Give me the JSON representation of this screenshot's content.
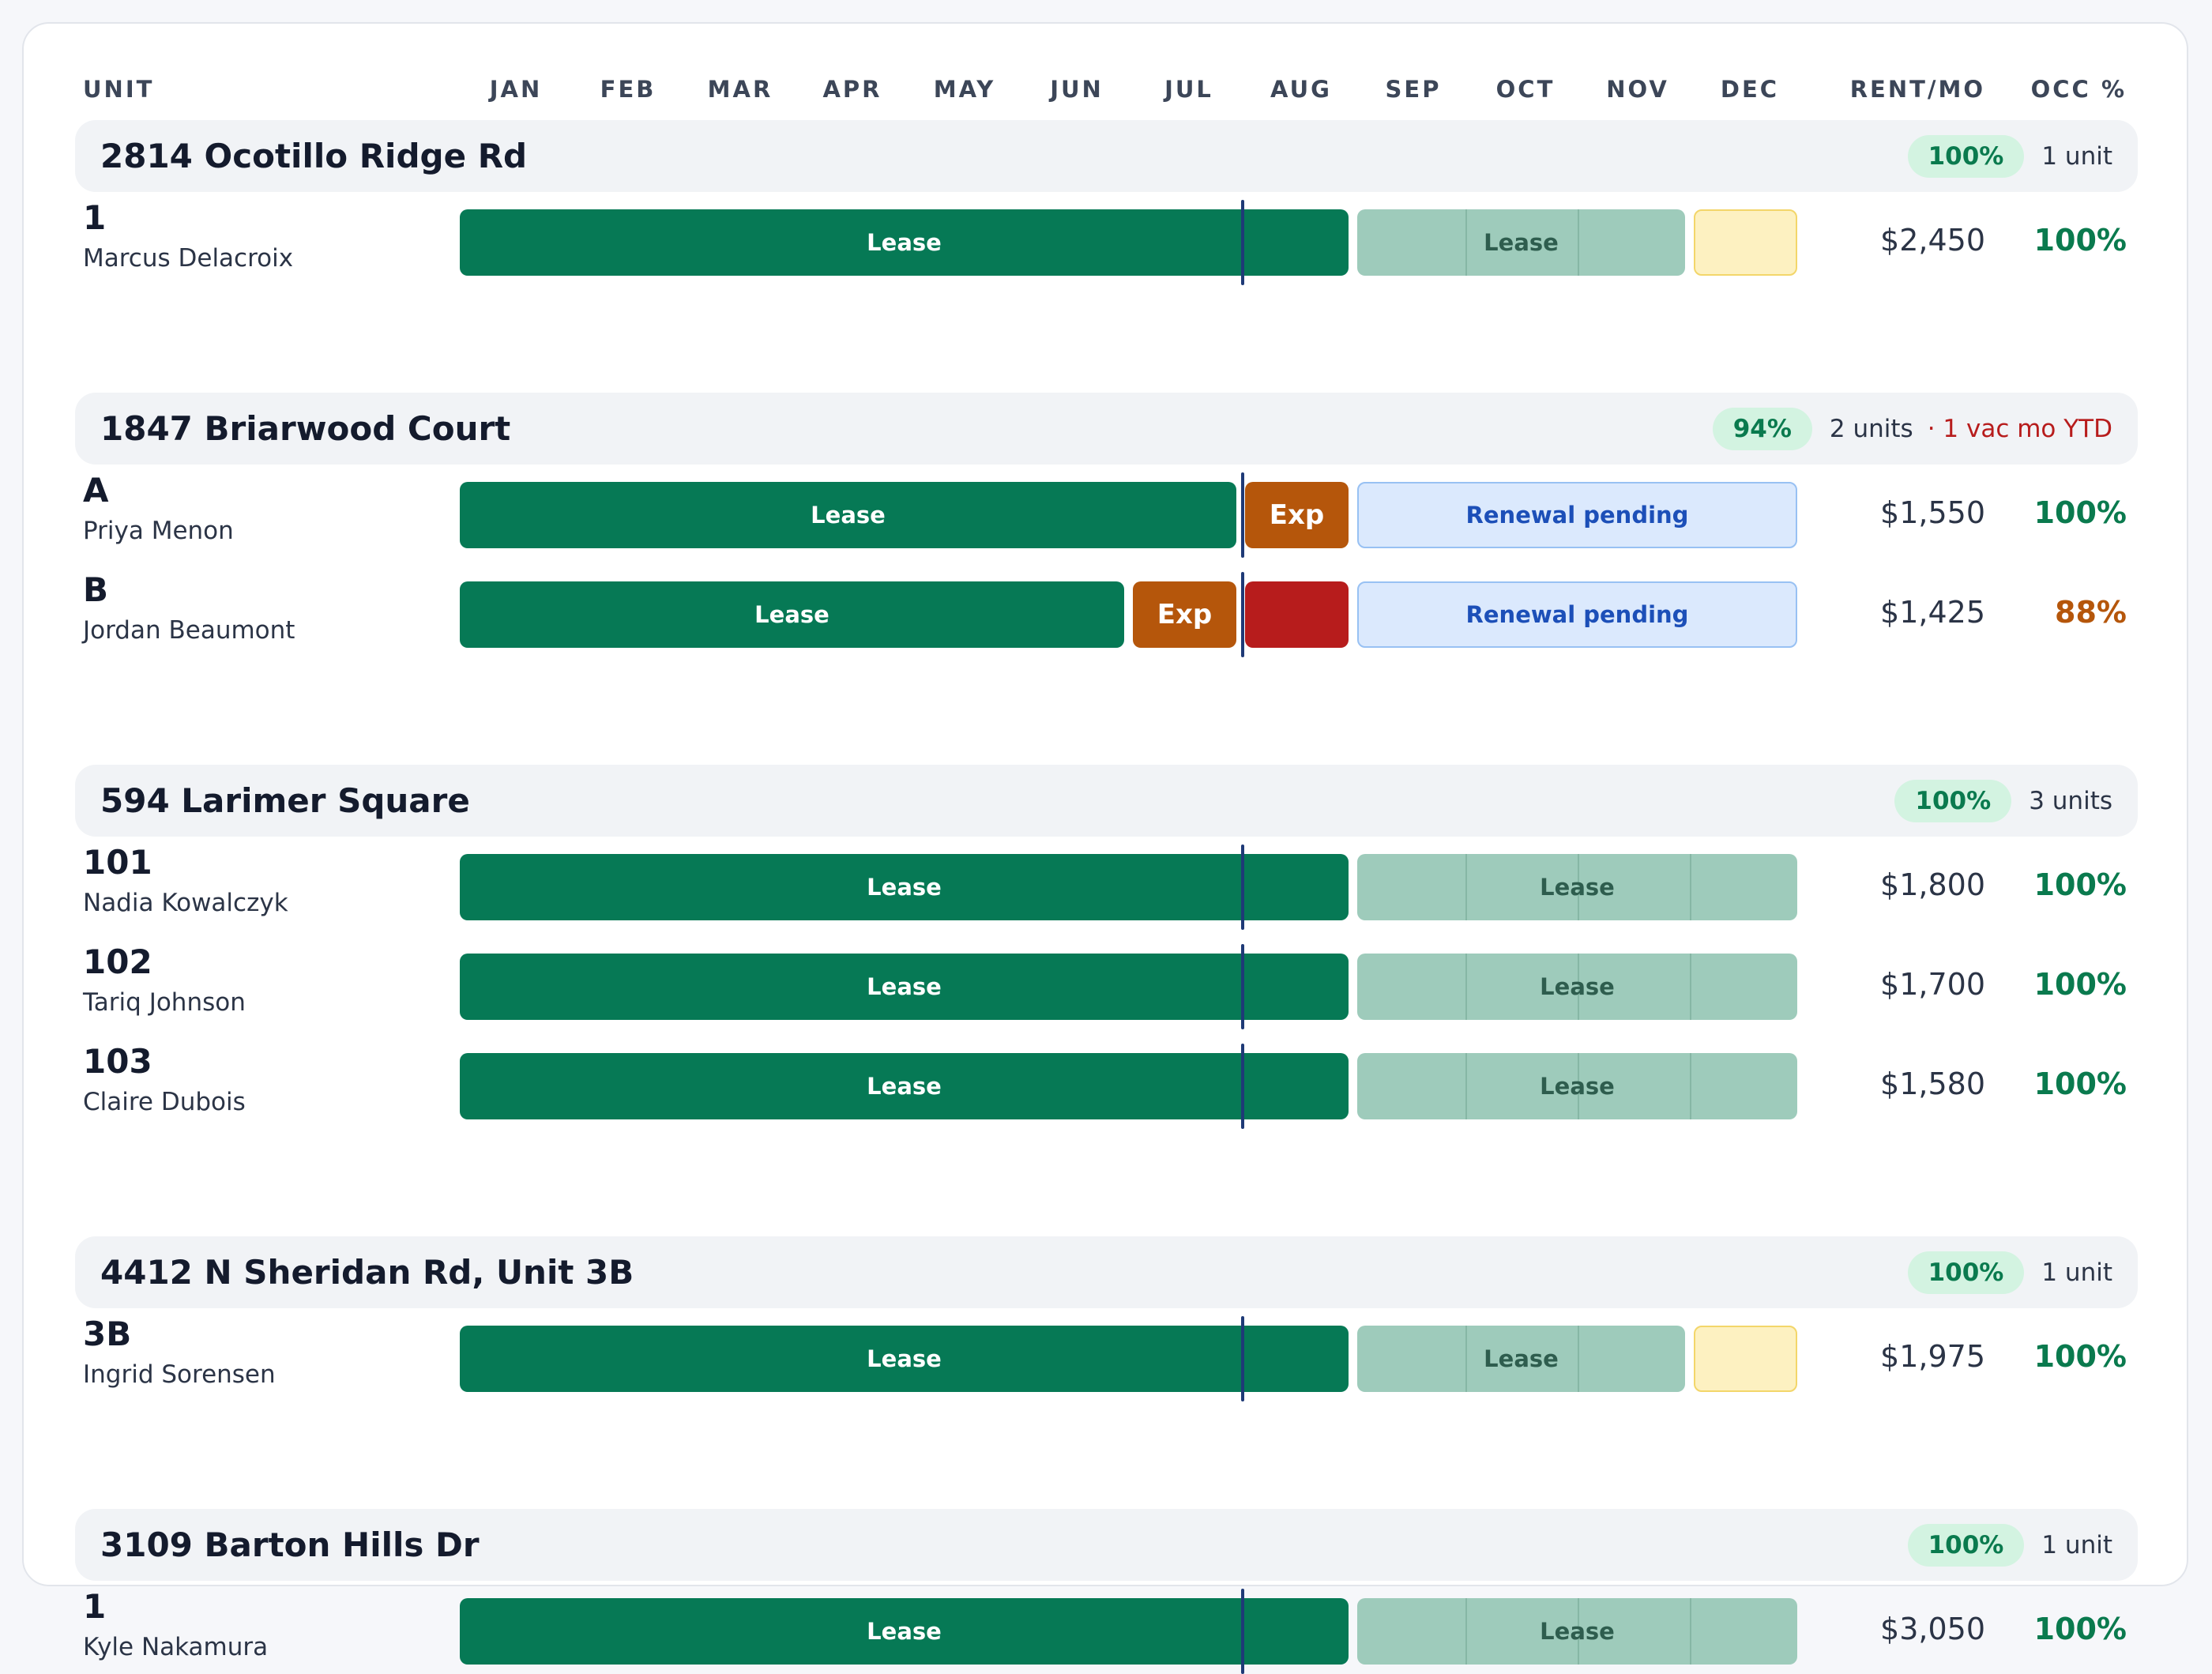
{
  "columns": {
    "unit": "UNIT",
    "months": [
      "JAN",
      "FEB",
      "MAR",
      "APR",
      "MAY",
      "JUN",
      "JUL",
      "AUG",
      "SEP",
      "OCT",
      "NOV",
      "DEC"
    ],
    "rent": "RENT/MO",
    "occ": "OCC %"
  },
  "legend_labels": {
    "lease": "Lease",
    "exp": "Exp",
    "renewal": "Renewal pending"
  },
  "colors": {
    "lease": "#067955",
    "future_lease": "#9ecbbb",
    "pending": "#fdf1c1",
    "renewal": "#dbe9fd",
    "expiring": "#b5560b",
    "vacant": "#b71c1c",
    "today_marker": "#1f3a77"
  },
  "properties": [
    {
      "name": "2814 Ocotillo Ridge Rd",
      "occupancy": "100%",
      "units_label": "1 unit",
      "vacancy_note": "",
      "units": [
        {
          "id": "1",
          "tenant": "Marcus Delacroix",
          "rent": "$2,450",
          "occ": "100%",
          "occ_warn": false,
          "segments": [
            {
              "type": "lease",
              "label": "Lease",
              "start": 0,
              "end": 8
            },
            {
              "type": "future",
              "label": "Lease",
              "start": 8,
              "end": 11
            },
            {
              "type": "yellow",
              "label": "",
              "start": 11,
              "end": 12
            }
          ]
        }
      ]
    },
    {
      "name": "1847 Briarwood Court",
      "occupancy": "94%",
      "units_label": "2 units",
      "vacancy_note": "· 1 vac mo YTD",
      "units": [
        {
          "id": "A",
          "tenant": "Priya Menon",
          "rent": "$1,550",
          "occ": "100%",
          "occ_warn": false,
          "segments": [
            {
              "type": "lease",
              "label": "Lease",
              "start": 0,
              "end": 7
            },
            {
              "type": "exp",
              "label": "Exp",
              "start": 7,
              "end": 8
            },
            {
              "type": "renew",
              "label": "Renewal pending",
              "start": 8,
              "end": 12
            }
          ]
        },
        {
          "id": "B",
          "tenant": "Jordan Beaumont",
          "rent": "$1,425",
          "occ": "88%",
          "occ_warn": true,
          "segments": [
            {
              "type": "lease",
              "label": "Lease",
              "start": 0,
              "end": 6
            },
            {
              "type": "exp",
              "label": "Exp",
              "start": 6,
              "end": 7
            },
            {
              "type": "vac",
              "label": "",
              "start": 7,
              "end": 8
            },
            {
              "type": "renew",
              "label": "Renewal pending",
              "start": 8,
              "end": 12
            }
          ]
        }
      ]
    },
    {
      "name": "594 Larimer Square",
      "occupancy": "100%",
      "units_label": "3 units",
      "vacancy_note": "",
      "units": [
        {
          "id": "101",
          "tenant": "Nadia Kowalczyk",
          "rent": "$1,800",
          "occ": "100%",
          "occ_warn": false,
          "segments": [
            {
              "type": "lease",
              "label": "Lease",
              "start": 0,
              "end": 8
            },
            {
              "type": "future",
              "label": "Lease",
              "start": 8,
              "end": 12
            }
          ]
        },
        {
          "id": "102",
          "tenant": "Tariq Johnson",
          "rent": "$1,700",
          "occ": "100%",
          "occ_warn": false,
          "segments": [
            {
              "type": "lease",
              "label": "Lease",
              "start": 0,
              "end": 8
            },
            {
              "type": "future",
              "label": "Lease",
              "start": 8,
              "end": 12
            }
          ]
        },
        {
          "id": "103",
          "tenant": "Claire Dubois",
          "rent": "$1,580",
          "occ": "100%",
          "occ_warn": false,
          "segments": [
            {
              "type": "lease",
              "label": "Lease",
              "start": 0,
              "end": 8
            },
            {
              "type": "future",
              "label": "Lease",
              "start": 8,
              "end": 12
            }
          ]
        }
      ]
    },
    {
      "name": "4412 N Sheridan Rd, Unit 3B",
      "occupancy": "100%",
      "units_label": "1 unit",
      "vacancy_note": "",
      "units": [
        {
          "id": "3B",
          "tenant": "Ingrid Sorensen",
          "rent": "$1,975",
          "occ": "100%",
          "occ_warn": false,
          "segments": [
            {
              "type": "lease",
              "label": "Lease",
              "start": 0,
              "end": 8
            },
            {
              "type": "future",
              "label": "Lease",
              "start": 8,
              "end": 11
            },
            {
              "type": "yellow",
              "label": "",
              "start": 11,
              "end": 12
            }
          ]
        }
      ]
    },
    {
      "name": "3109 Barton Hills Dr",
      "occupancy": "100%",
      "units_label": "1 unit",
      "vacancy_note": "",
      "units": [
        {
          "id": "1",
          "tenant": "Kyle Nakamura",
          "rent": "$3,050",
          "occ": "100%",
          "occ_warn": false,
          "segments": [
            {
              "type": "lease",
              "label": "Lease",
              "start": 0,
              "end": 8
            },
            {
              "type": "future",
              "label": "Lease",
              "start": 8,
              "end": 12
            }
          ]
        }
      ]
    }
  ]
}
